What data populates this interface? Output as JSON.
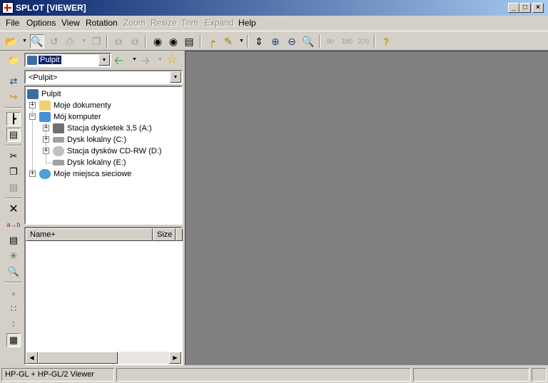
{
  "window": {
    "title": "SPLOT [VIEWER]"
  },
  "menu": {
    "file": "File",
    "options": "Options",
    "view": "View",
    "rotation": "Rotation",
    "zoom": "Zoom",
    "resize": "Resize",
    "trim": "Trim",
    "expand": "Expand",
    "help": "Help"
  },
  "toolbar": {
    "rot90": "90",
    "rot180": "180",
    "rot270": "270"
  },
  "browser": {
    "folder_combo": "Pulpit",
    "path_combo": "<Pulpit>",
    "tree": {
      "root": "Pulpit",
      "my_documents": "Moje dokumenty",
      "my_computer": "Mój komputer",
      "floppy": "Stacja dyskietek 3,5 (A:)",
      "disk_c": "Dysk lokalny (C:)",
      "cdrw": "Stacja dysków CD-RW (D:)",
      "disk_e": "Dysk lokalny (E:)",
      "network": "Moje miejsca sieciowe"
    },
    "list_columns": {
      "name": "Name+",
      "size": "Size"
    }
  },
  "status": {
    "text": "HP-GL + HP-GL/2 Viewer"
  },
  "colors": {
    "titlebar_start": "#0a246a",
    "titlebar_end": "#a6caf0",
    "viewer_bg": "#808080",
    "face": "#d4d0c8"
  }
}
